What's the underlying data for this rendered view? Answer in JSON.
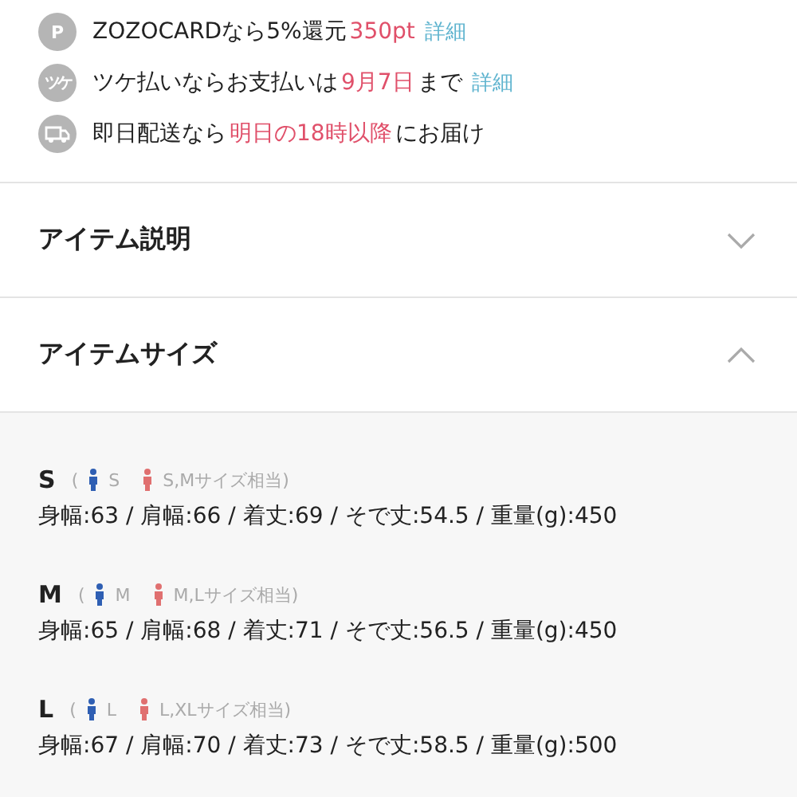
{
  "info_rows": [
    {
      "kind": "badge",
      "icon_label": "P",
      "segments": [
        {
          "kind": "plain",
          "text": "ZOZOCARDなら5%還元"
        },
        {
          "kind": "accent",
          "text": "350pt"
        },
        {
          "kind": "link",
          "text": "詳細"
        }
      ]
    },
    {
      "kind": "badge",
      "icon_label": "ツケ",
      "segments": [
        {
          "kind": "plain",
          "text": "ツケ払いならお支払いは"
        },
        {
          "kind": "accent",
          "text": "9月7日"
        },
        {
          "kind": "plain",
          "text": "まで"
        },
        {
          "kind": "link",
          "text": "詳細"
        }
      ]
    },
    {
      "kind": "truck",
      "segments": [
        {
          "kind": "plain",
          "text": "即日配送なら"
        },
        {
          "kind": "accent",
          "text": "明日の18時以降"
        },
        {
          "kind": "plain",
          "text": "にお届け"
        }
      ]
    }
  ],
  "sections": [
    {
      "title": "アイテム説明",
      "expanded": false
    },
    {
      "title": "アイテムサイズ",
      "expanded": true
    }
  ],
  "sizes": [
    {
      "label": "S",
      "open": "(",
      "men": "S",
      "women": "S,Mサイズ相当)",
      "measurements": "身幅:63 / 肩幅:66 / 着丈:69 / そで丈:54.5 / 重量(g):450"
    },
    {
      "label": "M",
      "open": "(",
      "men": "M",
      "women": "M,Lサイズ相当)",
      "measurements": "身幅:65 / 肩幅:68 / 着丈:71 / そで丈:56.5 / 重量(g):450"
    },
    {
      "label": "L",
      "open": "(",
      "men": "L",
      "women": "L,XLサイズ相当)",
      "measurements": "身幅:67 / 肩幅:70 / 着丈:73 / そで丈:58.5 / 重量(g):500"
    }
  ]
}
